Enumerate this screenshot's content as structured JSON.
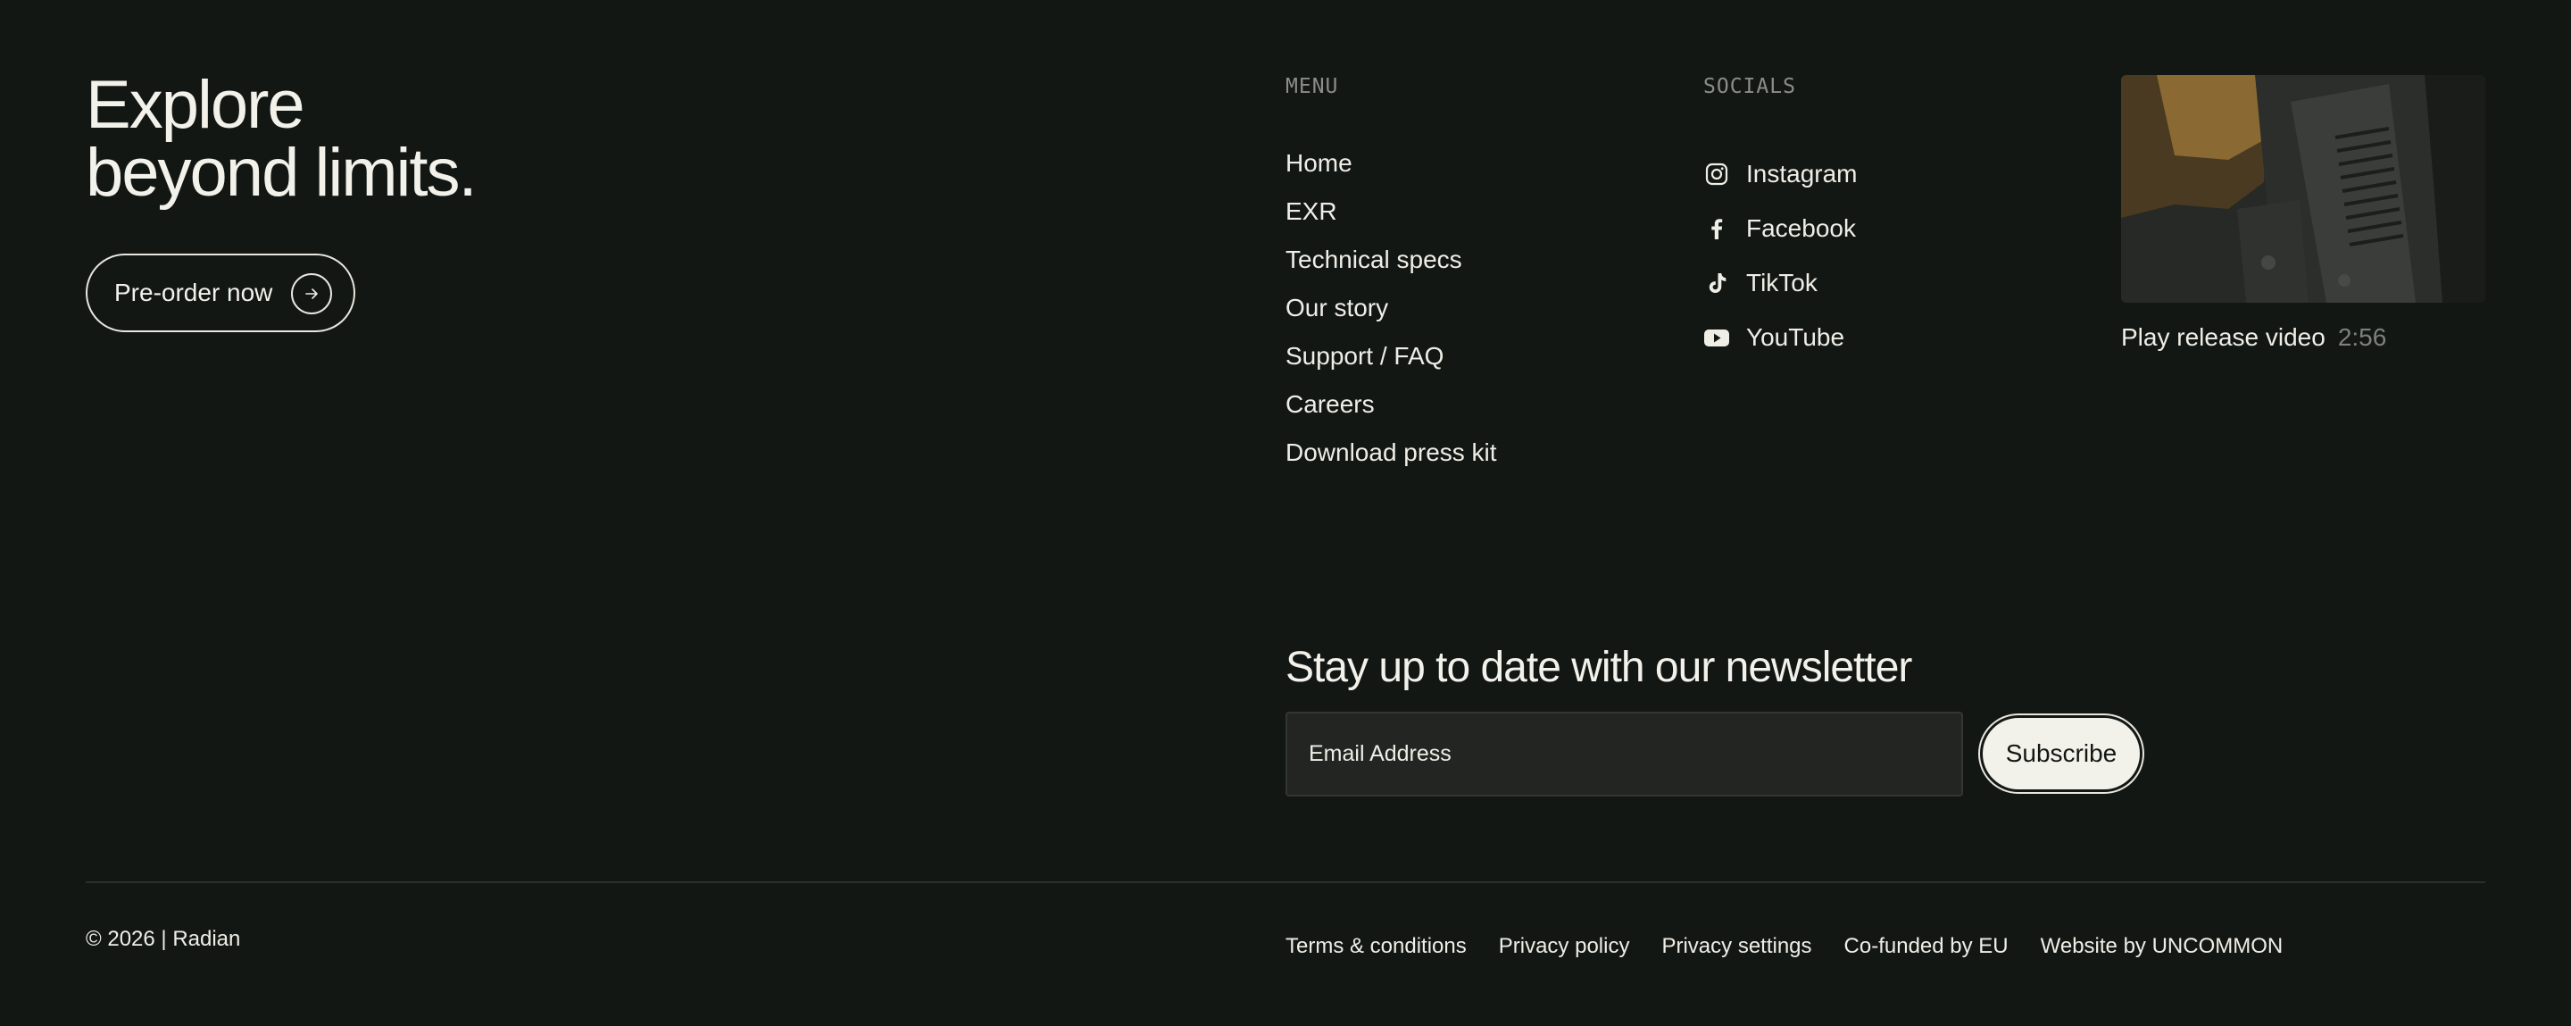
{
  "hero": {
    "headline_line1": "Explore",
    "headline_line2": "beyond limits.",
    "cta_label": "Pre-order now"
  },
  "menu": {
    "label": "MENU",
    "items": [
      {
        "label": "Home"
      },
      {
        "label": "EXR"
      },
      {
        "label": "Technical specs"
      },
      {
        "label": "Our story"
      },
      {
        "label": "Support / FAQ"
      },
      {
        "label": "Careers"
      },
      {
        "label": "Download press kit"
      }
    ]
  },
  "socials": {
    "label": "SOCIALS",
    "items": [
      {
        "label": "Instagram",
        "icon": "instagram-icon"
      },
      {
        "label": "Facebook",
        "icon": "facebook-icon"
      },
      {
        "label": "TikTok",
        "icon": "tiktok-icon"
      },
      {
        "label": "YouTube",
        "icon": "youtube-icon"
      }
    ]
  },
  "video": {
    "caption": "Play release video",
    "duration": "2:56"
  },
  "newsletter": {
    "title": "Stay up to date with our newsletter",
    "email_placeholder": "Email Address",
    "subscribe_label": "Subscribe"
  },
  "footer": {
    "copyright": "© 2026 | Radian",
    "links": [
      {
        "label": "Terms & conditions"
      },
      {
        "label": "Privacy policy"
      },
      {
        "label": "Privacy settings"
      },
      {
        "label": "Co-funded by EU"
      },
      {
        "label": "Website by UNCOMMON"
      }
    ]
  },
  "colors": {
    "background": "#131714",
    "text": "#eeeee6",
    "muted": "#8a8d88",
    "input_bg": "#222522",
    "button_bg": "#f2f1ea"
  }
}
